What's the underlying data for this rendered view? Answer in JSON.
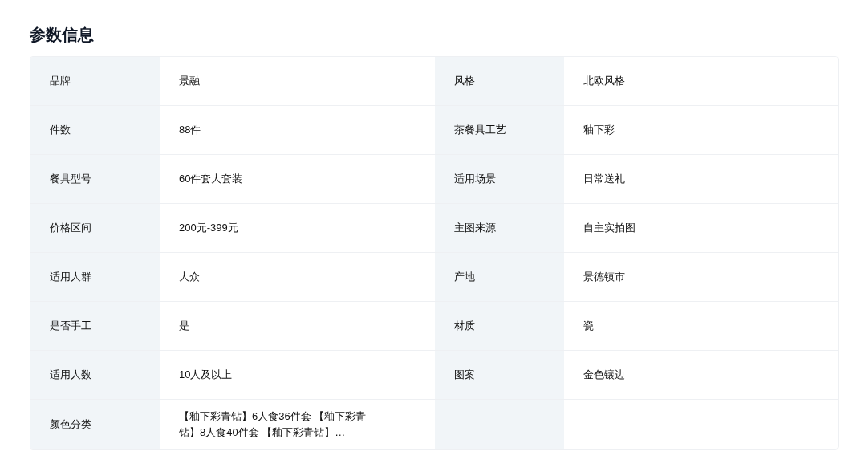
{
  "title": "参数信息",
  "params": [
    {
      "label": "品牌",
      "value": "景融"
    },
    {
      "label": "风格",
      "value": "北欧风格"
    },
    {
      "label": "件数",
      "value": "88件"
    },
    {
      "label": "茶餐具工艺",
      "value": "釉下彩"
    },
    {
      "label": "餐具型号",
      "value": "60件套大套装"
    },
    {
      "label": "适用场景",
      "value": "日常送礼"
    },
    {
      "label": "价格区间",
      "value": "200元-399元"
    },
    {
      "label": "主图来源",
      "value": "自主实拍图"
    },
    {
      "label": "适用人群",
      "value": "大众"
    },
    {
      "label": "产地",
      "value": "景德镇市"
    },
    {
      "label": "是否手工",
      "value": "是"
    },
    {
      "label": "材质",
      "value": "瓷"
    },
    {
      "label": "适用人数",
      "value": "10人及以上"
    },
    {
      "label": "图案",
      "value": "金色镶边"
    },
    {
      "label": "颜色分类",
      "value": "【釉下彩青钻】6人食36件套 【釉下彩青钻】8人食40件套 【釉下彩青钻】…"
    }
  ]
}
